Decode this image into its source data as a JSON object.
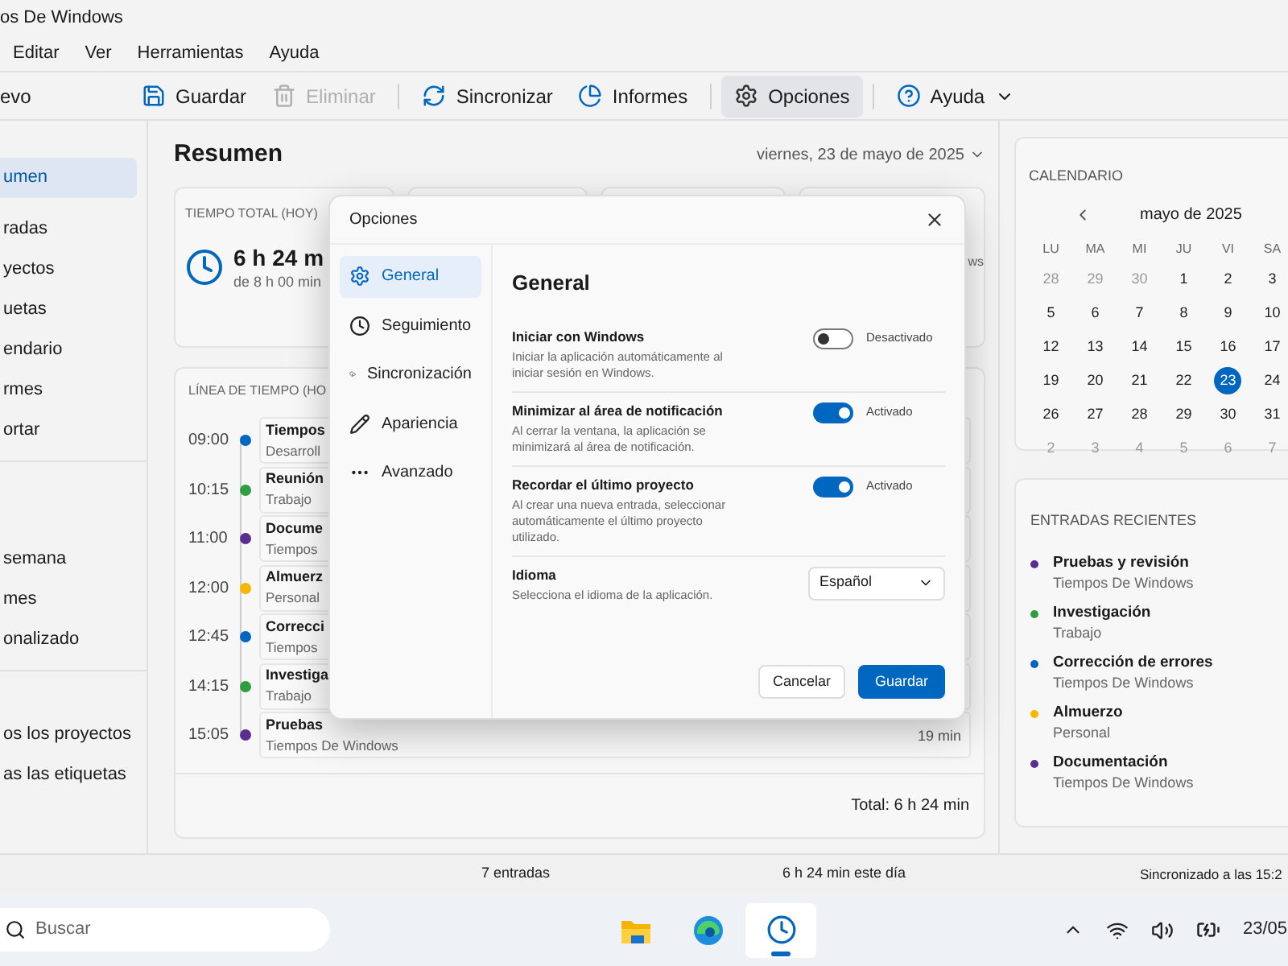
{
  "window": {
    "title": "os De Windows"
  },
  "menu": [
    "Editar",
    "Ver",
    "Herramientas",
    "Ayuda"
  ],
  "toolbar": {
    "new_label": "evo",
    "buttons": [
      {
        "kind": "save",
        "label": "Guardar",
        "disabled": false,
        "selected": false
      },
      {
        "kind": "delete",
        "label": "Eliminar",
        "disabled": true,
        "selected": false
      },
      {
        "kind": "sync",
        "label": "Sincronizar",
        "disabled": false,
        "selected": false
      },
      {
        "kind": "reports",
        "label": "Informes",
        "disabled": false,
        "selected": false
      },
      {
        "kind": "options",
        "label": "Opciones",
        "disabled": false,
        "selected": true
      },
      {
        "kind": "help",
        "label": "Ayuda",
        "disabled": false,
        "selected": false
      }
    ]
  },
  "sidebar": {
    "groups": [
      [
        {
          "label": "umen",
          "selected": true
        },
        {
          "label": "radas",
          "selected": false
        },
        {
          "label": "yectos",
          "selected": false
        },
        {
          "label": "uetas",
          "selected": false
        },
        {
          "label": "endario",
          "selected": false
        },
        {
          "label": "rmes",
          "selected": false
        },
        {
          "label": "ortar",
          "selected": false
        }
      ],
      [
        {
          "label": "semana",
          "selected": false
        },
        {
          "label": "mes",
          "selected": false
        },
        {
          "label": "onalizado",
          "selected": false
        }
      ],
      [
        {
          "label": "os los proyectos",
          "selected": false
        },
        {
          "label": "as las etiquetas",
          "selected": false
        }
      ]
    ]
  },
  "summary": {
    "title": "Resumen",
    "date": "viernes, 23 de mayo de 2025",
    "total_card": {
      "label": "TIEMPO TOTAL (HOY)",
      "value": "6 h 24 m",
      "sub": "de 8 h 00 min"
    },
    "fourth_card": {
      "text": "ws"
    }
  },
  "timeline": {
    "title": "LÍNEA DE TIEMPO (HO",
    "entries": [
      {
        "time": "09:00",
        "title": "Tiempos",
        "sub": "Desarroll",
        "color": "#0067c0"
      },
      {
        "time": "10:15",
        "title": "Reunión",
        "sub": "Trabajo",
        "color": "#2e9e3e"
      },
      {
        "time": "11:00",
        "title": "Docume",
        "sub": "Tiempos",
        "color": "#5c2d91"
      },
      {
        "time": "12:00",
        "title": "Almuerz",
        "sub": "Personal",
        "color": "#f7b500"
      },
      {
        "time": "12:45",
        "title": "Correcci",
        "sub": "Tiempos",
        "color": "#0067c0"
      },
      {
        "time": "14:15",
        "title": "Investiga",
        "sub": "Trabajo",
        "color": "#2e9e3e"
      },
      {
        "time": "15:05",
        "title": "Pruebas",
        "sub": "Tiempos De Windows",
        "duration": "19 min",
        "color": "#5c2d91"
      }
    ],
    "total": "Total: 6 h 24 min"
  },
  "calendar": {
    "title": "CALENDARIO",
    "month": "mayo de 2025",
    "weekdays": [
      "LU",
      "MA",
      "MI",
      "JU",
      "VI",
      "SA"
    ],
    "weeks": [
      [
        {
          "d": "28",
          "outside": true,
          "selected": false
        },
        {
          "d": "29",
          "outside": true,
          "selected": false
        },
        {
          "d": "30",
          "outside": true,
          "selected": false
        },
        {
          "d": "1",
          "outside": false,
          "selected": false
        },
        {
          "d": "2",
          "outside": false,
          "selected": false
        },
        {
          "d": "3",
          "outside": false,
          "selected": false
        }
      ],
      [
        {
          "d": "5",
          "outside": false,
          "selected": false
        },
        {
          "d": "6",
          "outside": false,
          "selected": false
        },
        {
          "d": "7",
          "outside": false,
          "selected": false
        },
        {
          "d": "8",
          "outside": false,
          "selected": false
        },
        {
          "d": "9",
          "outside": false,
          "selected": false
        },
        {
          "d": "10",
          "outside": false,
          "selected": false
        }
      ],
      [
        {
          "d": "12",
          "outside": false,
          "selected": false
        },
        {
          "d": "13",
          "outside": false,
          "selected": false
        },
        {
          "d": "14",
          "outside": false,
          "selected": false
        },
        {
          "d": "15",
          "outside": false,
          "selected": false
        },
        {
          "d": "16",
          "outside": false,
          "selected": false
        },
        {
          "d": "17",
          "outside": false,
          "selected": false
        }
      ],
      [
        {
          "d": "19",
          "outside": false,
          "selected": false
        },
        {
          "d": "20",
          "outside": false,
          "selected": false
        },
        {
          "d": "21",
          "outside": false,
          "selected": false
        },
        {
          "d": "22",
          "outside": false,
          "selected": false
        },
        {
          "d": "23",
          "outside": false,
          "selected": true
        },
        {
          "d": "24",
          "outside": false,
          "selected": false
        }
      ],
      [
        {
          "d": "26",
          "outside": false,
          "selected": false
        },
        {
          "d": "27",
          "outside": false,
          "selected": false
        },
        {
          "d": "28",
          "outside": false,
          "selected": false
        },
        {
          "d": "29",
          "outside": false,
          "selected": false
        },
        {
          "d": "30",
          "outside": false,
          "selected": false
        },
        {
          "d": "31",
          "outside": false,
          "selected": false
        }
      ],
      [
        {
          "d": "2",
          "outside": true,
          "selected": false
        },
        {
          "d": "3",
          "outside": true,
          "selected": false
        },
        {
          "d": "4",
          "outside": true,
          "selected": false
        },
        {
          "d": "5",
          "outside": true,
          "selected": false
        },
        {
          "d": "6",
          "outside": true,
          "selected": false
        },
        {
          "d": "7",
          "outside": true,
          "selected": false
        }
      ]
    ]
  },
  "recent": {
    "title": "ENTRADAS RECIENTES",
    "items": [
      {
        "title": "Pruebas y revisión",
        "sub": "Tiempos De Windows",
        "color": "#5c2d91"
      },
      {
        "title": "Investigación",
        "sub": "Trabajo",
        "color": "#2e9e3e"
      },
      {
        "title": "Corrección de errores",
        "sub": "Tiempos De Windows",
        "color": "#0067c0"
      },
      {
        "title": "Almuerzo",
        "sub": "Personal",
        "color": "#f7b500"
      },
      {
        "title": "Documentación",
        "sub": "Tiempos De Windows",
        "color": "#5c2d91"
      }
    ]
  },
  "status_bar": {
    "entries": "7 entradas",
    "today": "6 h 24 min este día",
    "sync": "Sincronizado a las 15:2"
  },
  "dialog": {
    "title": "Opciones",
    "nav": [
      {
        "kind": "general",
        "label": "General",
        "selected": true
      },
      {
        "kind": "tracking",
        "label": "Seguimiento",
        "selected": false
      },
      {
        "kind": "sync",
        "label": "Sincronización",
        "selected": false
      },
      {
        "kind": "appearance",
        "label": "Apariencia",
        "selected": false
      },
      {
        "kind": "advanced",
        "label": "Avanzado",
        "selected": false
      }
    ],
    "heading": "General",
    "settings": [
      {
        "kind": "toggle",
        "title": "Iniciar con Windows",
        "desc": "Iniciar la aplicación automáticamente al iniciar sesión en Windows.",
        "on": false,
        "state_label": "Desactivado"
      },
      {
        "kind": "toggle",
        "title": "Minimizar al área de notificación",
        "desc": "Al cerrar la ventana, la aplicación se minimizará al área de notificación.",
        "on": true,
        "state_label": "Activado"
      },
      {
        "kind": "toggle",
        "title": "Recordar el último proyecto",
        "desc": "Al crear una nueva entrada, seleccionar automáticamente el último proyecto utilizado.",
        "on": true,
        "state_label": "Activado"
      },
      {
        "kind": "select",
        "title": "Idioma",
        "desc": "Selecciona el idioma de la aplicación.",
        "value": "Español"
      }
    ],
    "buttons": [
      {
        "kind": "secondary",
        "label": "Cancelar"
      },
      {
        "kind": "primary",
        "label": "Guardar"
      }
    ]
  },
  "taskbar": {
    "search_placeholder": "Buscar",
    "apps": [
      {
        "kind": "folder",
        "selected": false
      },
      {
        "kind": "browser",
        "selected": false
      },
      {
        "kind": "clock",
        "selected": true
      }
    ],
    "date": "23/05"
  }
}
